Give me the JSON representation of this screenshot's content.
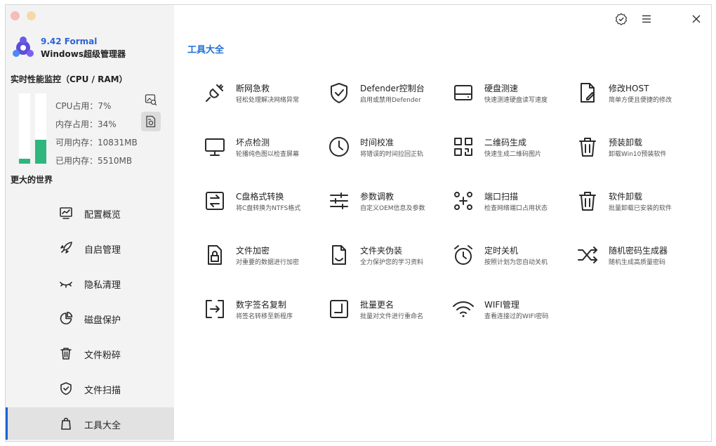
{
  "app": {
    "version": "9.42 Formal",
    "name": "Windows超级管理器"
  },
  "monitor": {
    "title": "实时性能监控（CPU / RAM）",
    "cpu_label": "CPU占用：7%",
    "mem_label": "内存占用：34%",
    "avail_label": "可用内存：10831MB",
    "used_label": "已用内存：5510MB",
    "cpu_percent": 7,
    "mem_percent": 34,
    "bar_color": "#2fb67c"
  },
  "sidebar": {
    "world_label": "更大的世界",
    "items": [
      {
        "label": "配置概览",
        "icon": "chart-icon"
      },
      {
        "label": "自启管理",
        "icon": "rocket-icon"
      },
      {
        "label": "隐私清理",
        "icon": "eye-closed-icon"
      },
      {
        "label": "磁盘保护",
        "icon": "pie-icon"
      },
      {
        "label": "文件粉碎",
        "icon": "trash-icon"
      },
      {
        "label": "文件扫描",
        "icon": "shield-icon"
      },
      {
        "label": "工具大全",
        "icon": "bag-icon",
        "active": true
      }
    ]
  },
  "main": {
    "title": "工具大全",
    "accent_color": "#1f6fd6",
    "tools": [
      {
        "name": "断网急救",
        "desc": "轻松处理解决网络异常",
        "icon": "plug-icon"
      },
      {
        "name": "Defender控制台",
        "desc": "启用或禁用Defender",
        "icon": "shield-check-icon"
      },
      {
        "name": "硬盘测速",
        "desc": "快速测速硬盘读写速度",
        "icon": "harddisk-icon"
      },
      {
        "name": "修改HOST",
        "desc": "简单方便且便捷的修改",
        "icon": "file-edit-icon"
      },
      {
        "name": "坏点检测",
        "desc": "轮播纯色图以检查屏幕",
        "icon": "monitor-icon"
      },
      {
        "name": "时间校准",
        "desc": "将错误的时间拉回正轨",
        "icon": "clock-icon"
      },
      {
        "name": "二维码生成",
        "desc": "快速生成二维码图片",
        "icon": "qrcode-icon"
      },
      {
        "name": "预装卸载",
        "desc": "卸载Win10预装软件",
        "icon": "trash-icon"
      },
      {
        "name": "C盘格式转换",
        "desc": "将C盘转换为NTFS格式",
        "icon": "convert-icon"
      },
      {
        "name": "参数调教",
        "desc": "自定义OEM信息及参数",
        "icon": "sliders-icon"
      },
      {
        "name": "端口扫描",
        "desc": "检查网络端口占用状态",
        "icon": "network-icon"
      },
      {
        "name": "软件卸载",
        "desc": "批量卸载已安装的软件",
        "icon": "trash-icon"
      },
      {
        "name": "文件加密",
        "desc": "对重要的数据进行加密",
        "icon": "file-lock-icon"
      },
      {
        "name": "文件夹伪装",
        "desc": "全力保护您的学习资料",
        "icon": "file-eye-icon"
      },
      {
        "name": "定时关机",
        "desc": "按照计划为您自动关机",
        "icon": "alarm-icon"
      },
      {
        "name": "随机密码生成器",
        "desc": "随机生成高质量密码",
        "icon": "shuffle-icon"
      },
      {
        "name": "数字签名复制",
        "desc": "将签名转移至新程序",
        "icon": "sign-transfer-icon"
      },
      {
        "name": "批量更名",
        "desc": "批量对文件进行重命名",
        "icon": "rename-icon"
      },
      {
        "name": "WIFI管理",
        "desc": "查看连接过的WIFI密码",
        "icon": "wifi-icon"
      }
    ]
  }
}
